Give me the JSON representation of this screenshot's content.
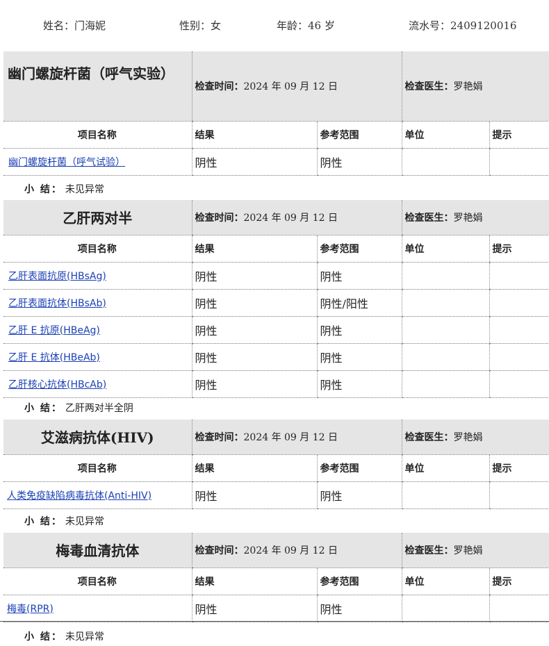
{
  "patient": {
    "name_label": "姓名：",
    "name": "门海妮",
    "gender_label": "性别：",
    "gender": "女",
    "age_label": "年龄：",
    "age": "46 岁",
    "serial_label": "流水号：",
    "serial": "2409120016"
  },
  "common": {
    "time_label": "检查时间：",
    "doctor_label": "检查医生：",
    "col_item": "项目名称",
    "col_result": "结果",
    "col_range": "参考范围",
    "col_unit": "单位",
    "col_hint": "提示",
    "summary_label": "小 结："
  },
  "sections": [
    {
      "title": "幽门螺旋杆菌（呼气实验）",
      "time": "2024 年 09 月 12 日",
      "doctor": "罗艳娟",
      "rows": [
        {
          "item": "幽门螺旋杆菌（呼气试验）",
          "result": "阴性",
          "range": "阴性",
          "unit": "",
          "hint": ""
        }
      ],
      "summary": "未见异常"
    },
    {
      "title": "乙肝两对半",
      "time": "2024 年 09 月 12 日",
      "doctor": "罗艳娟",
      "rows": [
        {
          "item": "乙肝表面抗原(HBsAg)",
          "result": "阴性",
          "range": "阴性",
          "unit": "",
          "hint": ""
        },
        {
          "item": "乙肝表面抗体(HBsAb)",
          "result": "阴性",
          "range": "阴性/阳性",
          "unit": "",
          "hint": ""
        },
        {
          "item": "乙肝 E 抗原(HBeAg)",
          "result": "阴性",
          "range": "阴性",
          "unit": "",
          "hint": ""
        },
        {
          "item": "乙肝 E 抗体(HBeAb)",
          "result": "阴性",
          "range": "阴性",
          "unit": "",
          "hint": ""
        },
        {
          "item": "乙肝核心抗体(HBcAb)",
          "result": "阴性",
          "range": "阴性",
          "unit": "",
          "hint": ""
        }
      ],
      "summary": "乙肝两对半全阴"
    },
    {
      "title": "艾滋病抗体(HIV)",
      "time": "2024 年 09 月 12 日",
      "doctor": "罗艳娟",
      "rows": [
        {
          "item": "人类免疫缺陷病毒抗体(Anti-HIV)",
          "result": "阴性",
          "range": "阴性",
          "unit": "",
          "hint": ""
        }
      ],
      "summary": "未见异常"
    },
    {
      "title": "梅毒血清抗体",
      "time": "2024 年 09 月 12 日",
      "doctor": "罗艳娟",
      "rows": [
        {
          "item": "梅毒(RPR)",
          "result": "阴性",
          "range": "阴性",
          "unit": "",
          "hint": ""
        }
      ],
      "summary": "未见异常"
    }
  ]
}
